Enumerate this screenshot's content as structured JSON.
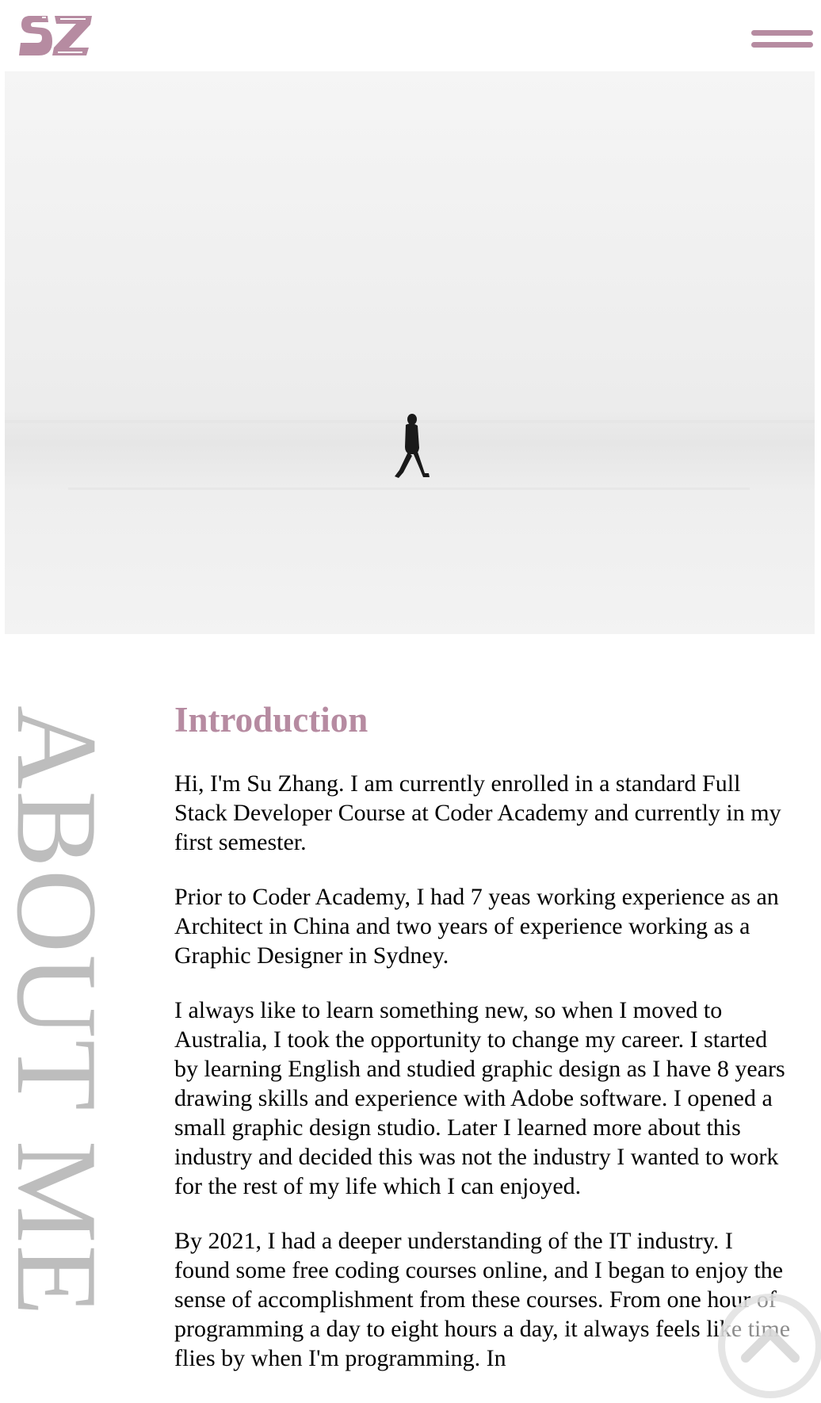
{
  "header": {
    "logo_text": "SZ",
    "menu_icon": "hamburger-menu-icon",
    "brand_color": "#b68ba1"
  },
  "hero": {
    "image_subject": "lone figure walking across a snowy field"
  },
  "about": {
    "vertical_title": "ABOUT ME",
    "heading": "Introduction",
    "paragraphs": [
      "Hi, I'm Su Zhang. I am currently enrolled in a standard Full Stack Developer Course at Coder Academy and currently in my first semester.",
      "Prior to Coder Academy, I had 7 yeas working experience as an Architect in China and two years of experience working as a Graphic Designer in Sydney.",
      "I always like to learn something new, so when I moved to Australia, I took the opportunity to change my career. I started by learning English and studied graphic design as I have 8 years drawing skills and experience with Adobe software. I opened a small graphic design studio. Later I learned more about this industry and decided this was not the industry I wanted to work for the rest of my life which I can enjoyed.",
      "By 2021, I had a deeper understanding of the IT industry. I found some free coding courses online, and I began to enjoy the sense of accomplishment from these courses. From one hour of programming a day to eight hours a day, it always feels like time flies by when I'm programming. In"
    ]
  },
  "scroll_top": {
    "icon": "chevron-up-icon"
  },
  "colors": {
    "accent": "#b68ba1",
    "vertical_title": "#bdbdbd",
    "body_text": "#000000"
  }
}
